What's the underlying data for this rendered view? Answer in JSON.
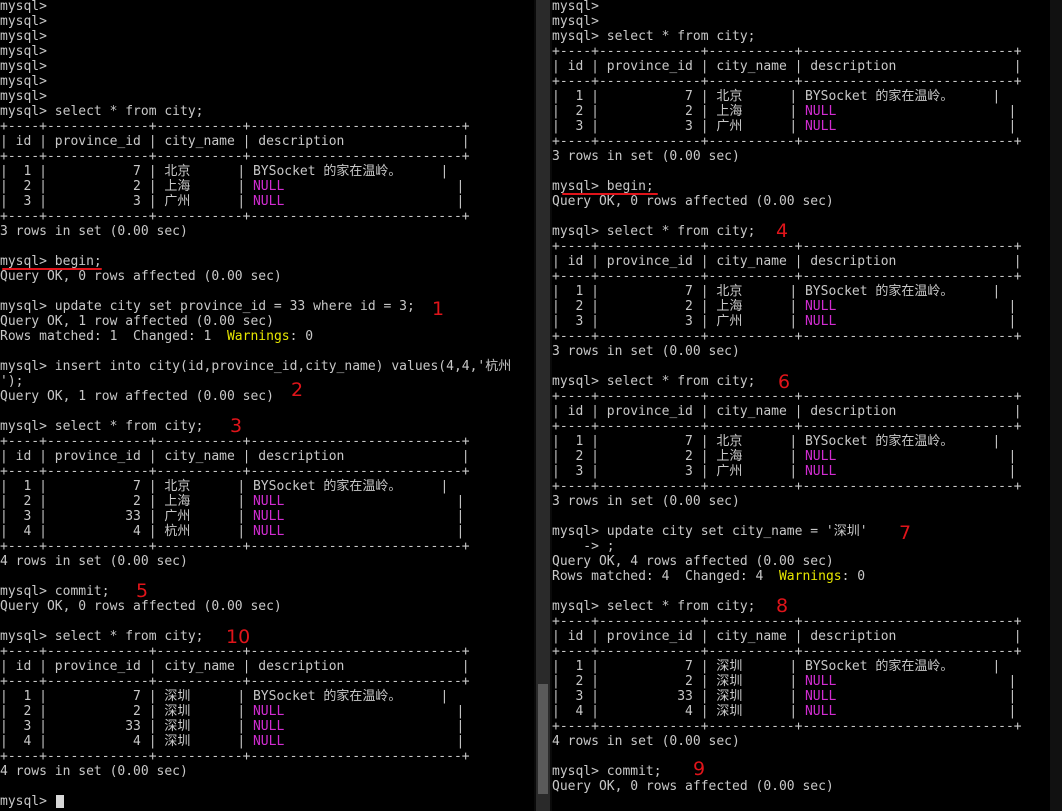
{
  "left_pane": {
    "lines": [
      {
        "text": "mysql>"
      },
      {
        "text": "mysql>"
      },
      {
        "text": "mysql>"
      },
      {
        "text": "mysql>"
      },
      {
        "text": "mysql>"
      },
      {
        "text": "mysql>"
      },
      {
        "text": "mysql>"
      },
      {
        "text": "mysql> select * from city;"
      },
      {
        "text": "+----+-------------+-----------+---------------------------+"
      },
      {
        "text": "| id | province_id | city_name | description               |"
      },
      {
        "text": "+----+-------------+-----------+---------------------------+"
      },
      {
        "text": "|  1 |           7 | 北京      | BYSocket 的家在温岭。     |"
      },
      {
        "text": "|  2 |           2 | 上海      | ",
        "null": true,
        "tail": "                      |"
      },
      {
        "text": "|  3 |           3 | 广州      | ",
        "null": true,
        "tail": "                      |"
      },
      {
        "text": "+----+-------------+-----------+---------------------------+"
      },
      {
        "text": "3 rows in set (0.00 sec)"
      },
      {
        "text": ""
      },
      {
        "text": "mysql> begin;"
      },
      {
        "text": "Query OK, 0 rows affected (0.00 sec)"
      },
      {
        "text": ""
      },
      {
        "text": "mysql> update city set province_id = 33 where id = 3;"
      },
      {
        "text": "Query OK, 1 row affected (0.00 sec)"
      },
      {
        "text": "Rows matched: 1  Changed: 1  ",
        "warn": "Warnings",
        "tail": ": 0"
      },
      {
        "text": ""
      },
      {
        "text": "mysql> insert into city(id,province_id,city_name) values(4,4,'杭州"
      },
      {
        "text": "');"
      },
      {
        "text": "Query OK, 1 row affected (0.00 sec)"
      },
      {
        "text": ""
      },
      {
        "text": "mysql> select * from city;"
      },
      {
        "text": "+----+-------------+-----------+---------------------------+"
      },
      {
        "text": "| id | province_id | city_name | description               |"
      },
      {
        "text": "+----+-------------+-----------+---------------------------+"
      },
      {
        "text": "|  1 |           7 | 北京      | BYSocket 的家在温岭。     |"
      },
      {
        "text": "|  2 |           2 | 上海      | ",
        "null": true,
        "tail": "                      |"
      },
      {
        "text": "|  3 |          33 | 广州      | ",
        "null": true,
        "tail": "                      |"
      },
      {
        "text": "|  4 |           4 | 杭州      | ",
        "null": true,
        "tail": "                      |"
      },
      {
        "text": "+----+-------------+-----------+---------------------------+"
      },
      {
        "text": "4 rows in set (0.00 sec)"
      },
      {
        "text": ""
      },
      {
        "text": "mysql> commit;"
      },
      {
        "text": "Query OK, 0 rows affected (0.00 sec)"
      },
      {
        "text": ""
      },
      {
        "text": "mysql> select * from city;"
      },
      {
        "text": "+----+-------------+-----------+---------------------------+"
      },
      {
        "text": "| id | province_id | city_name | description               |"
      },
      {
        "text": "+----+-------------+-----------+---------------------------+"
      },
      {
        "text": "|  1 |           7 | 深圳      | BYSocket 的家在温岭。     |"
      },
      {
        "text": "|  2 |           2 | 深圳      | ",
        "null": true,
        "tail": "                      |"
      },
      {
        "text": "|  3 |          33 | 深圳      | ",
        "null": true,
        "tail": "                      |"
      },
      {
        "text": "|  4 |           4 | 深圳      | ",
        "null": true,
        "tail": "                      |"
      },
      {
        "text": "+----+-------------+-----------+---------------------------+"
      },
      {
        "text": "4 rows in set (0.00 sec)"
      },
      {
        "text": ""
      },
      {
        "text": "mysql> "
      }
    ],
    "annotations": [
      "1",
      "2",
      "3",
      "5",
      "10"
    ]
  },
  "right_pane": {
    "lines": [
      {
        "text": "mysql>"
      },
      {
        "text": "mysql>"
      },
      {
        "text": "mysql> select * from city;"
      },
      {
        "text": "+----+-------------+-----------+---------------------------+"
      },
      {
        "text": "| id | province_id | city_name | description               |"
      },
      {
        "text": "+----+-------------+-----------+---------------------------+"
      },
      {
        "text": "|  1 |           7 | 北京      | BYSocket 的家在温岭。     |"
      },
      {
        "text": "|  2 |           2 | 上海      | ",
        "null": true,
        "tail": "                      |"
      },
      {
        "text": "|  3 |           3 | 广州      | ",
        "null": true,
        "tail": "                      |"
      },
      {
        "text": "+----+-------------+-----------+---------------------------+"
      },
      {
        "text": "3 rows in set (0.00 sec)"
      },
      {
        "text": ""
      },
      {
        "text": "mysql> begin;"
      },
      {
        "text": "Query OK, 0 rows affected (0.00 sec)"
      },
      {
        "text": ""
      },
      {
        "text": "mysql> select * from city;"
      },
      {
        "text": "+----+-------------+-----------+---------------------------+"
      },
      {
        "text": "| id | province_id | city_name | description               |"
      },
      {
        "text": "+----+-------------+-----------+---------------------------+"
      },
      {
        "text": "|  1 |           7 | 北京      | BYSocket 的家在温岭。     |"
      },
      {
        "text": "|  2 |           2 | 上海      | ",
        "null": true,
        "tail": "                      |"
      },
      {
        "text": "|  3 |           3 | 广州      | ",
        "null": true,
        "tail": "                      |"
      },
      {
        "text": "+----+-------------+-----------+---------------------------+"
      },
      {
        "text": "3 rows in set (0.00 sec)"
      },
      {
        "text": ""
      },
      {
        "text": "mysql> select * from city;"
      },
      {
        "text": "+----+-------------+-----------+---------------------------+"
      },
      {
        "text": "| id | province_id | city_name | description               |"
      },
      {
        "text": "+----+-------------+-----------+---------------------------+"
      },
      {
        "text": "|  1 |           7 | 北京      | BYSocket 的家在温岭。     |"
      },
      {
        "text": "|  2 |           2 | 上海      | ",
        "null": true,
        "tail": "                      |"
      },
      {
        "text": "|  3 |           3 | 广州      | ",
        "null": true,
        "tail": "                      |"
      },
      {
        "text": "+----+-------------+-----------+---------------------------+"
      },
      {
        "text": "3 rows in set (0.00 sec)"
      },
      {
        "text": ""
      },
      {
        "text": "mysql> update city set city_name = '深圳'"
      },
      {
        "text": "    -> ;"
      },
      {
        "text": "Query OK, 4 rows affected (0.00 sec)"
      },
      {
        "text": "Rows matched: 4  Changed: 4  ",
        "warn": "Warnings",
        "tail": ": 0"
      },
      {
        "text": ""
      },
      {
        "text": "mysql> select * from city;"
      },
      {
        "text": "+----+-------------+-----------+---------------------------+"
      },
      {
        "text": "| id | province_id | city_name | description               |"
      },
      {
        "text": "+----+-------------+-----------+---------------------------+"
      },
      {
        "text": "|  1 |           7 | 深圳      | BYSocket 的家在温岭。     |"
      },
      {
        "text": "|  2 |           2 | 深圳      | ",
        "null": true,
        "tail": "                      |"
      },
      {
        "text": "|  3 |          33 | 深圳      | ",
        "null": true,
        "tail": "                      |"
      },
      {
        "text": "|  4 |           4 | 深圳      | ",
        "null": true,
        "tail": "                      |"
      },
      {
        "text": "+----+-------------+-----------+---------------------------+"
      },
      {
        "text": "4 rows in set (0.00 sec)"
      },
      {
        "text": ""
      },
      {
        "text": "mysql> commit;"
      },
      {
        "text": "Query OK, 0 rows affected (0.00 sec)"
      }
    ],
    "annotations": [
      "4",
      "6",
      "7",
      "8",
      "9"
    ]
  },
  "null_text": "NULL",
  "colors": {
    "background": "#000000",
    "text": "#c8c8c8",
    "null": "#d12cd1",
    "warnings": "#e6e600",
    "annotation": "#e0141a"
  }
}
